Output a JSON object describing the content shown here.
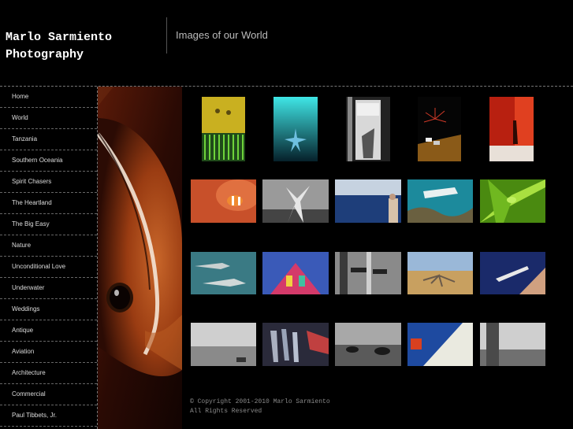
{
  "header": {
    "title_line1": "Marlo Sarmiento",
    "title_line2": "Photography",
    "tagline": "Images of our World"
  },
  "nav": {
    "items": [
      "Home",
      "World",
      "Tanzania",
      "Southern Oceania",
      "Spirit Chasers",
      "The Heartland",
      "The Big Easy",
      "Nature",
      "Unconditional Love",
      "Underwater",
      "Weddings",
      "Antique",
      "Aviation",
      "Architecture",
      "Commercial",
      "Paul Tibbets, Jr."
    ]
  },
  "footer": {
    "copyright_line1": "© Copyright 2001-2010 Marlo Sarmiento",
    "copyright_line2": "All Rights Reserved"
  }
}
